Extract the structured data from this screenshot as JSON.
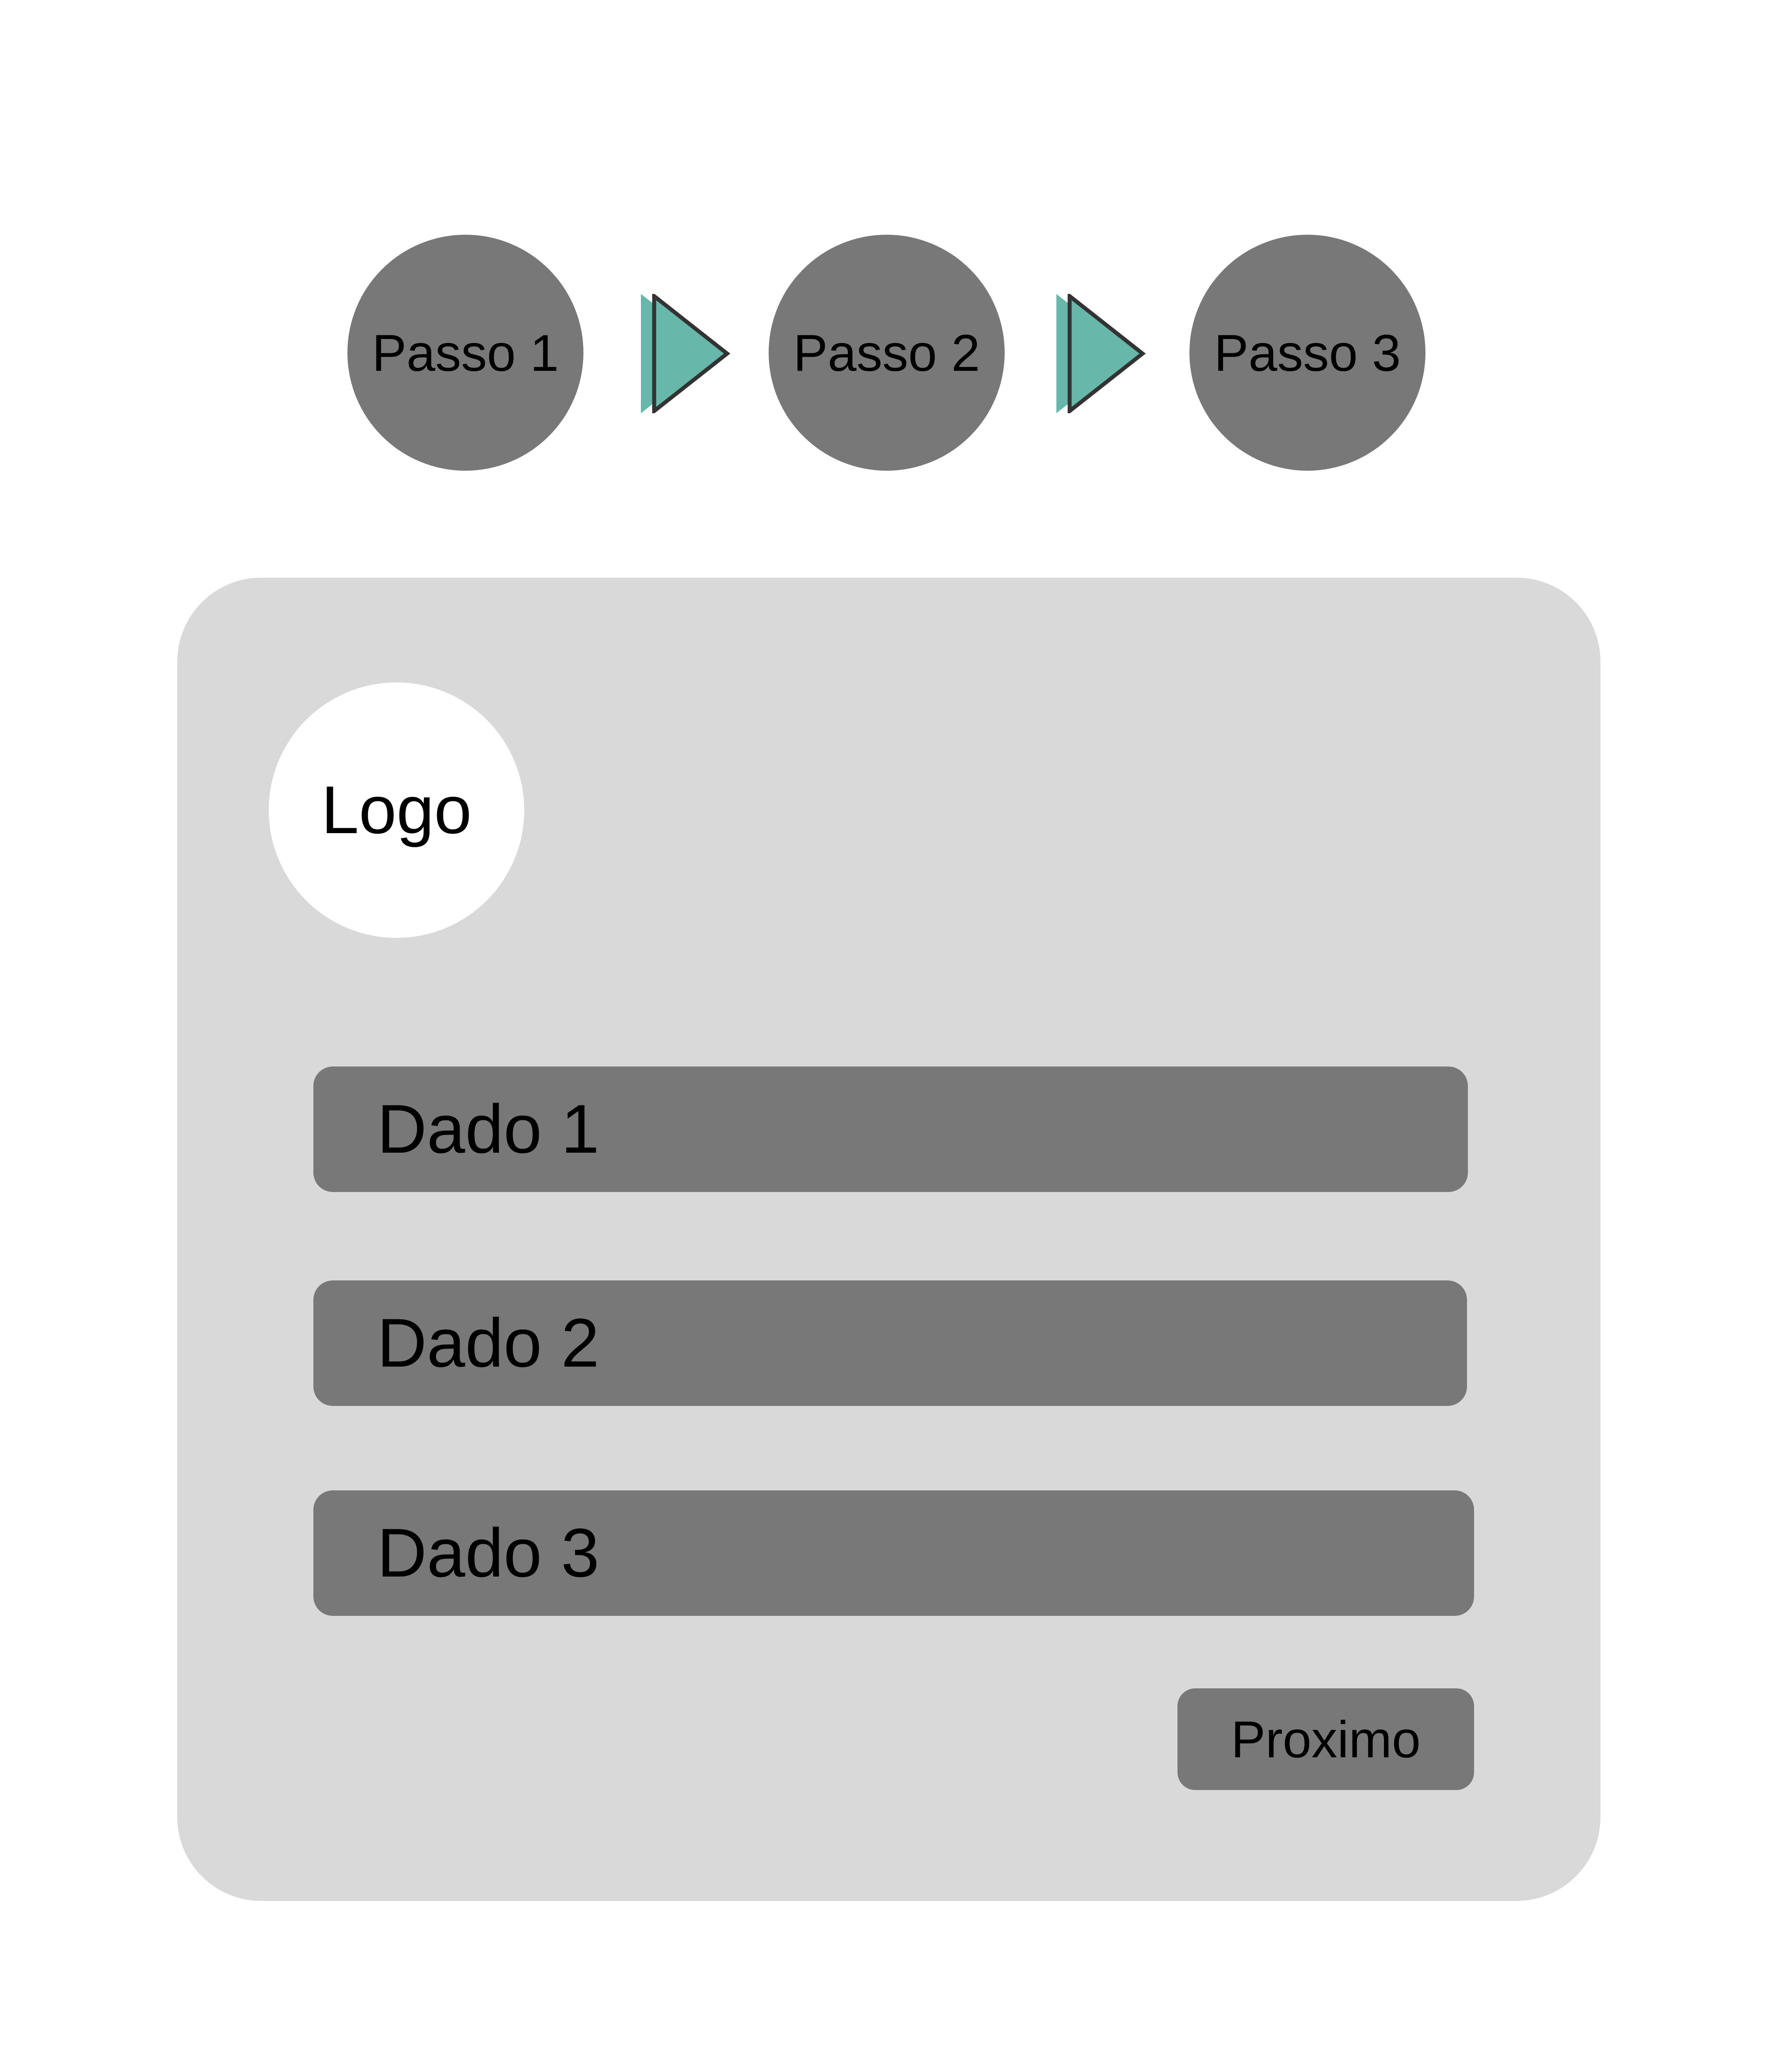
{
  "steps": [
    {
      "label": "Passo 1"
    },
    {
      "label": "Passo 2"
    },
    {
      "label": "Passo 3"
    }
  ],
  "arrows": [
    {
      "icon": "play-arrow-icon",
      "color": "#67b7aa"
    },
    {
      "icon": "play-arrow-icon",
      "color": "#67b7aa"
    }
  ],
  "card": {
    "logo": "Logo",
    "fields": [
      {
        "label": "Dado 1"
      },
      {
        "label": "Dado 2"
      },
      {
        "label": "Dado 3"
      }
    ],
    "next_button": "Proximo"
  },
  "colors": {
    "accent": "#67b7aa",
    "step_fill": "#787878",
    "card_background": "#d9d9d9",
    "page_background": "#ffffff"
  }
}
